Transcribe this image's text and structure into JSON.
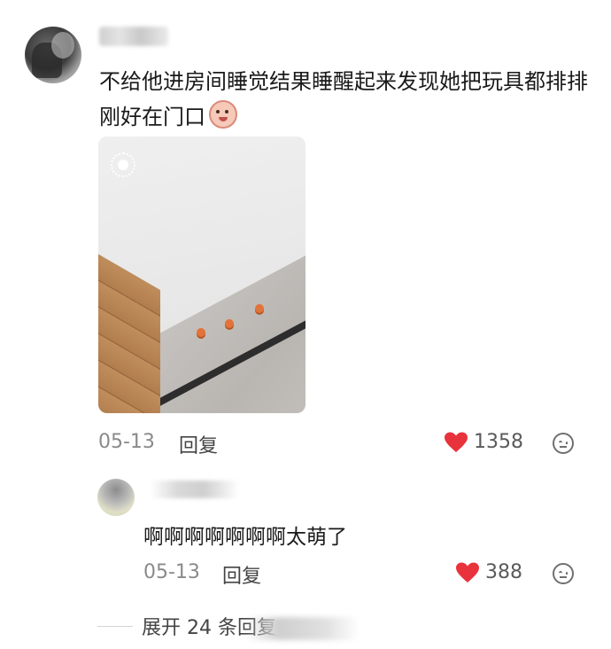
{
  "comment": {
    "text": "不给他进房间睡觉结果睡醒起来发现她把玩具都排排刚好在门口",
    "date": "05-13",
    "reply_label": "回复",
    "likes": "1358"
  },
  "reply": {
    "text": "啊啊啊啊啊啊啊太萌了",
    "date": "05-13",
    "reply_label": "回复",
    "likes": "388"
  },
  "expand": {
    "label": "展开 24 条回复"
  },
  "colors": {
    "heart": "#e8323c",
    "text": "#1a1a1a",
    "meta": "#8a8a8a"
  },
  "icons": {
    "like": "heart-icon",
    "emoji": "emoji-icon",
    "live_photo": "live-photo-icon"
  }
}
